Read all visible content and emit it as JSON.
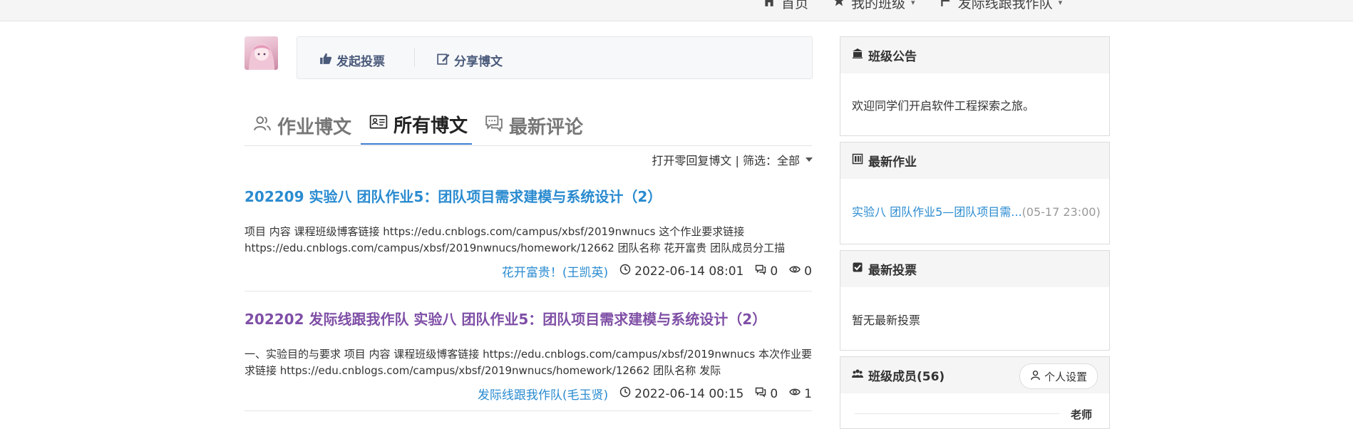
{
  "nav": {
    "home": "首页",
    "my_class": "我的班级",
    "team": "发际线跟我作队"
  },
  "actions": {
    "vote": "发起投票",
    "share": "分享博文"
  },
  "tabs": [
    {
      "label": "作业博文"
    },
    {
      "label": "所有博文"
    },
    {
      "label": "最新评论"
    }
  ],
  "filter": {
    "text": "打开零回复博文 | 筛选：全部"
  },
  "posts": [
    {
      "title": "202209 实验八 团队作业5：团队项目需求建模与系统设计（2）",
      "excerpt": "项目 内容 课程班级博客链接 https://edu.cnblogs.com/campus/xbsf/2019nwnucs 这个作业要求链接 https://edu.cnblogs.com/campus/xbsf/2019nwnucs/homework/12662 团队名称 花开富贵 团队成员分工描",
      "author": "花开富贵！(王凯英)",
      "date": "2022-06-14 08:01",
      "comments": "0",
      "views": "0"
    },
    {
      "title": "202202 发际线跟我作队 实验八 团队作业5：团队项目需求建模与系统设计（2）",
      "excerpt": "一、实验目的与要求 项目 内容 课程班级博客链接 https://edu.cnblogs.com/campus/xbsf/2019nwnucs 本次作业要求链接 https://edu.cnblogs.com/campus/xbsf/2019nwnucs/homework/12662 团队名称 发际",
      "author": "发际线跟我作队(毛玉贤)",
      "date": "2022-06-14 00:15",
      "comments": "0",
      "views": "1"
    }
  ],
  "sidebar": {
    "announcement": {
      "title": "班级公告",
      "text": "欢迎同学们开启软件工程探索之旅。"
    },
    "homework": {
      "title": "最新作业",
      "link": "实验八 团队作业5—团队项目需...",
      "deadline": "(05-17 23:00)"
    },
    "votes": {
      "title": "最新投票",
      "text": "暂无最新投票"
    },
    "members": {
      "title": "班级成员(56)",
      "settings": "个人设置",
      "teacher": "老师"
    }
  }
}
